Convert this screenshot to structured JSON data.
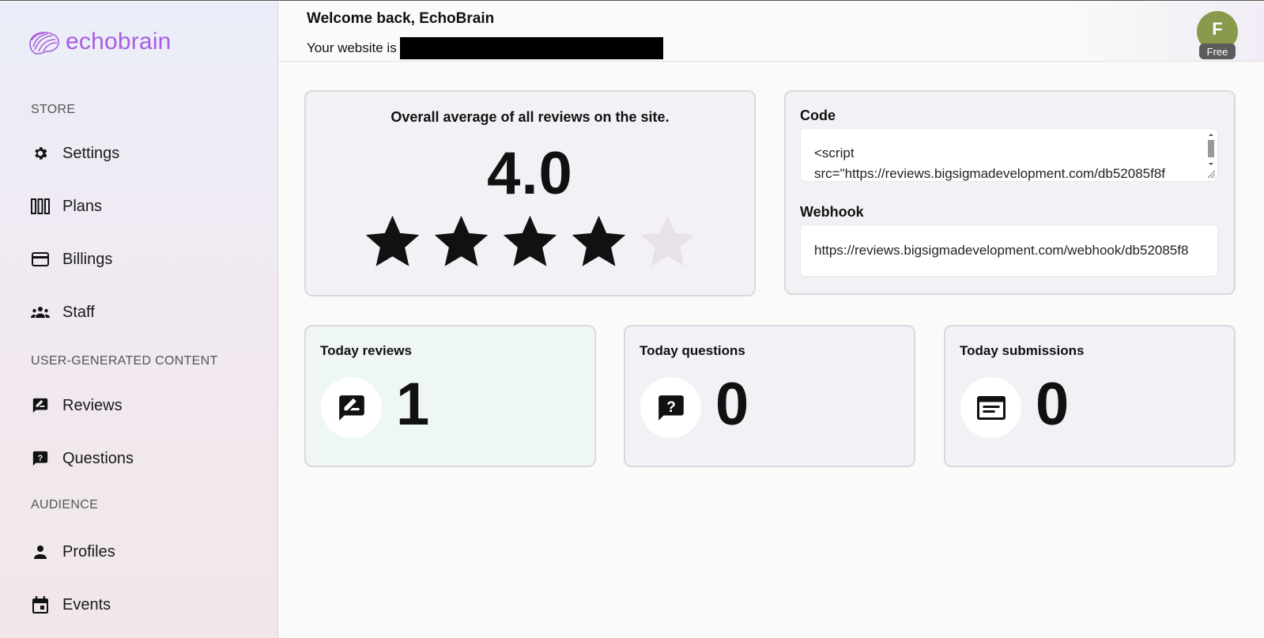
{
  "brand": {
    "name": "echobrain",
    "color": "#a85ee0"
  },
  "sidebar": {
    "sections": [
      {
        "label": "STORE"
      },
      {
        "label": "USER-GENERATED CONTENT"
      },
      {
        "label": "AUDIENCE"
      }
    ],
    "items": [
      {
        "label": "Settings",
        "icon": "gear-icon"
      },
      {
        "label": "Plans",
        "icon": "columns-icon"
      },
      {
        "label": "Billings",
        "icon": "credit-card-icon"
      },
      {
        "label": "Staff",
        "icon": "group-icon"
      },
      {
        "label": "Reviews",
        "icon": "rate-review-icon"
      },
      {
        "label": "Questions",
        "icon": "question-bubble-icon"
      },
      {
        "label": "Profiles",
        "icon": "person-icon"
      },
      {
        "label": "Events",
        "icon": "calendar-icon"
      }
    ]
  },
  "header": {
    "welcome": "Welcome back, EchoBrain",
    "website_prefix": "Your website is",
    "avatar_initial": "F",
    "plan": "Free",
    "avatar_color": "#8a9a4c"
  },
  "average": {
    "title": "Overall average of all reviews on the site.",
    "value": "4.0",
    "rating": 4,
    "max": 5
  },
  "integration": {
    "code_label": "Code",
    "code_value": "<script src=\"https://reviews.bigsigmadevelopment.com/db52085f8f",
    "webhook_label": "Webhook",
    "webhook_value": "https://reviews.bigsigmadevelopment.com/webhook/db52085f8"
  },
  "stats": [
    {
      "title": "Today reviews",
      "value": "1",
      "icon": "rate-review-icon"
    },
    {
      "title": "Today questions",
      "value": "0",
      "icon": "question-bubble-icon"
    },
    {
      "title": "Today submissions",
      "value": "0",
      "icon": "article-icon"
    }
  ]
}
